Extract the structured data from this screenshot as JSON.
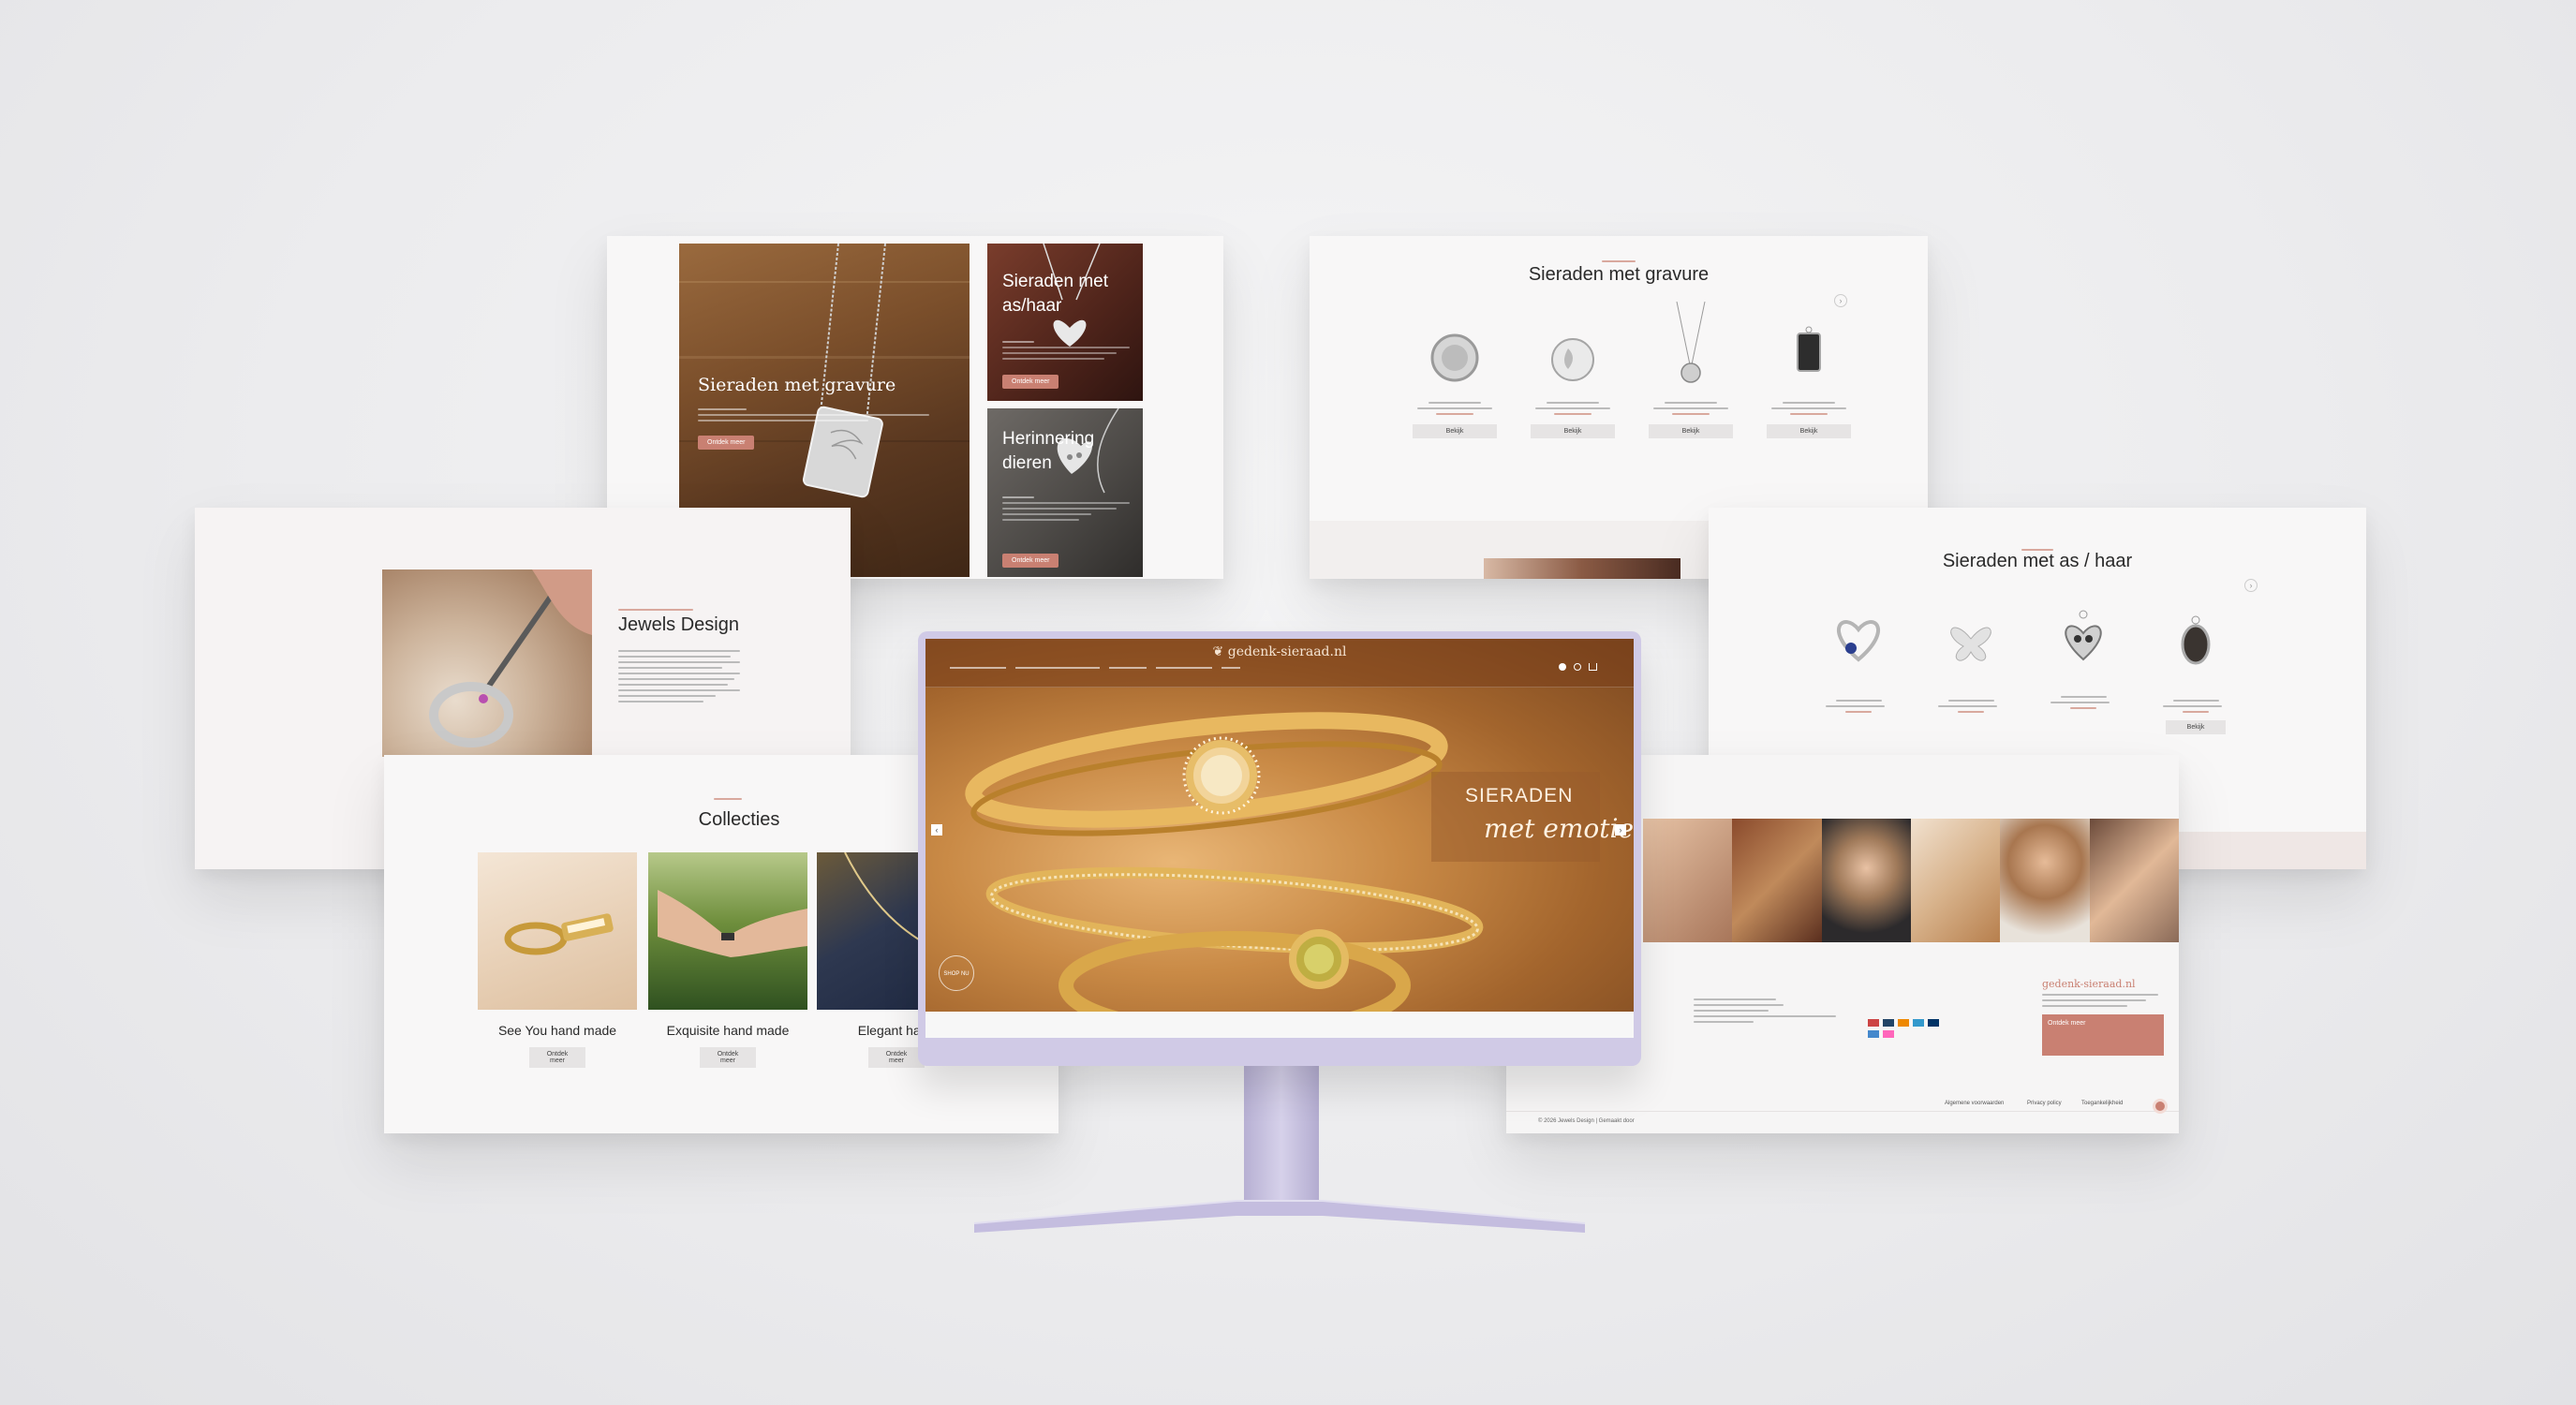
{
  "panel_hero_categories": {
    "big_title": "Sieraden met gravure",
    "big_button": "Ontdek meer",
    "tile1_title": "Sieraden met as/haar",
    "tile1_button": "Ontdek meer",
    "tile2_title": "Herinnering dieren",
    "tile2_button": "Ontdek meer"
  },
  "panel_gravure": {
    "title": "Sieraden met gravure",
    "buttons": [
      "Bekijk",
      "Bekijk",
      "Bekijk",
      "Bekijk"
    ]
  },
  "panel_jewels": {
    "title": "Jewels Design"
  },
  "panel_as_haar": {
    "title": "Sieraden met as / haar",
    "button": "Bekijk"
  },
  "panel_collecties": {
    "title": "Collecties",
    "items": [
      {
        "label": "See You hand made",
        "button": "Ontdek meer"
      },
      {
        "label": "Exquisite hand made",
        "button": "Ontdek meer"
      },
      {
        "label": "Elegant hand",
        "button": "Ontdek meer"
      }
    ]
  },
  "monitor": {
    "logo": "gedenk-sieraad.nl",
    "hero_line1": "SIERADEN",
    "hero_line2": "met emotie",
    "hero_button": "SHOP NU"
  },
  "panel_footer": {
    "logo": "gedenk-sieraad.nl",
    "cta": "Ontdek meer",
    "links": [
      "Algemene voorwaarden",
      "Privacy policy",
      "Toegankelijkheid"
    ],
    "copyright": "© 2026 Jewels Design | Gemaakt door"
  },
  "colors": {
    "accent_rose": "#c98072",
    "monitor_frame": "#c9c3e0"
  }
}
